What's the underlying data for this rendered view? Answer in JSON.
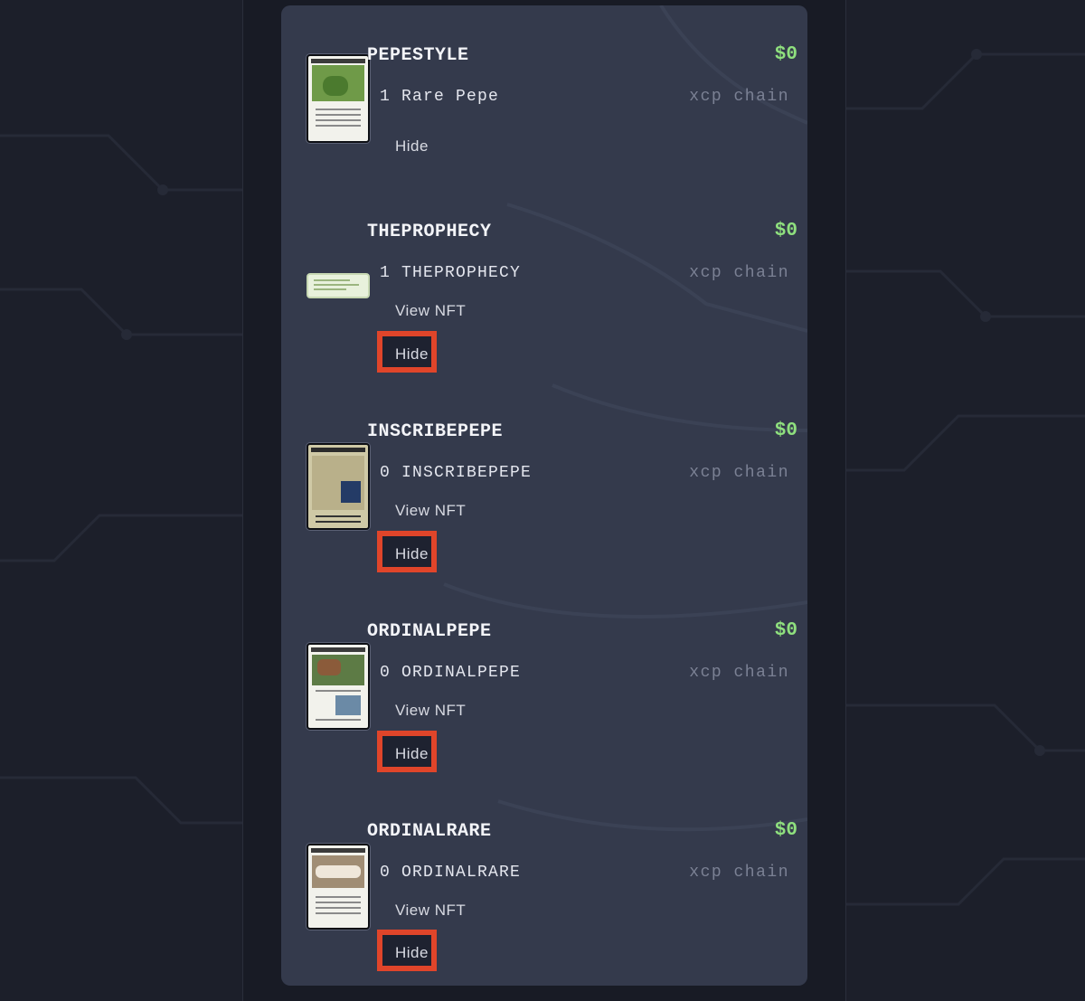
{
  "assets": [
    {
      "name": "PEPESTYLE",
      "value": "$0",
      "quantity": "1 Rare Pepe",
      "chain": "xcp chain",
      "view_label": "",
      "hide_label": "Hide",
      "hide_highlighted": false
    },
    {
      "name": "THEPROPHECY",
      "value": "$0",
      "quantity": "1 THEPROPHECY",
      "chain": "xcp chain",
      "view_label": "View NFT",
      "hide_label": "Hide",
      "hide_highlighted": true
    },
    {
      "name": "INSCRIBEPEPE",
      "value": "$0",
      "quantity": "0 INSCRIBEPEPE",
      "chain": "xcp chain",
      "view_label": "View NFT",
      "hide_label": "Hide",
      "hide_highlighted": true
    },
    {
      "name": "ORDINALPEPE",
      "value": "$0",
      "quantity": "0 ORDINALPEPE",
      "chain": "xcp chain",
      "view_label": "View NFT",
      "hide_label": "Hide",
      "hide_highlighted": true
    },
    {
      "name": "ORDINALRARE",
      "value": "$0",
      "quantity": "0 ORDINALRARE",
      "chain": "xcp chain",
      "view_label": "View NFT",
      "hide_label": "Hide",
      "hide_highlighted": true
    }
  ],
  "colors": {
    "panel_bg": "#343a4c",
    "value_green": "#8fe07e",
    "highlight_red": "#e0452a"
  }
}
